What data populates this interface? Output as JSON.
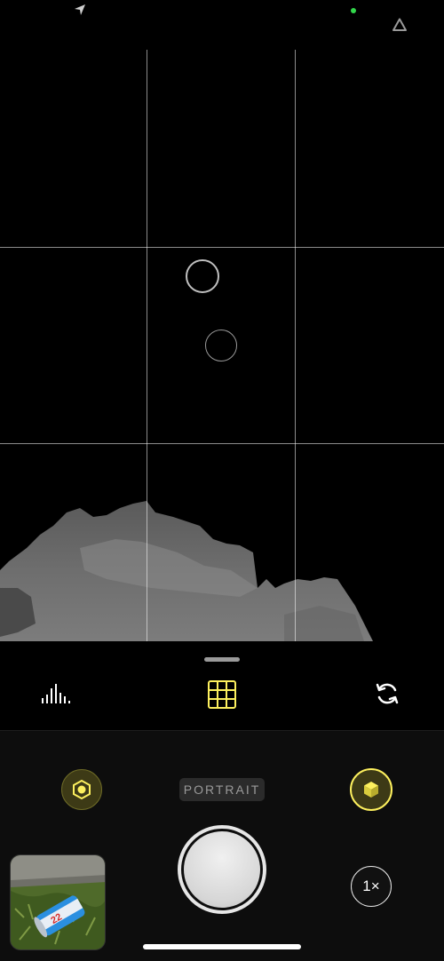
{
  "status_bar": {
    "location_icon": "location-arrow-icon",
    "camera_indicator_color": "#32d74b",
    "corner_icon": "triangle-outline-icon"
  },
  "viewfinder": {
    "grid": "3x3",
    "focus_indicators": 2,
    "preview": "depth-map-grayscale"
  },
  "toolbar": {
    "histogram_icon": "histogram-icon",
    "grid_icon": "grid-icon",
    "grid_active_color": "#fdf05e",
    "flip_icon": "rotate-camera-icon"
  },
  "controls": {
    "aperture_icon": "aperture-icon",
    "mode_label": "PORTRAIT",
    "depth_icon": "cube-icon",
    "accent_color": "#fdf05e",
    "zoom_label": "1×",
    "shutter_icon": "shutter-button",
    "thumbnail_icon": "last-photo-thumbnail"
  }
}
